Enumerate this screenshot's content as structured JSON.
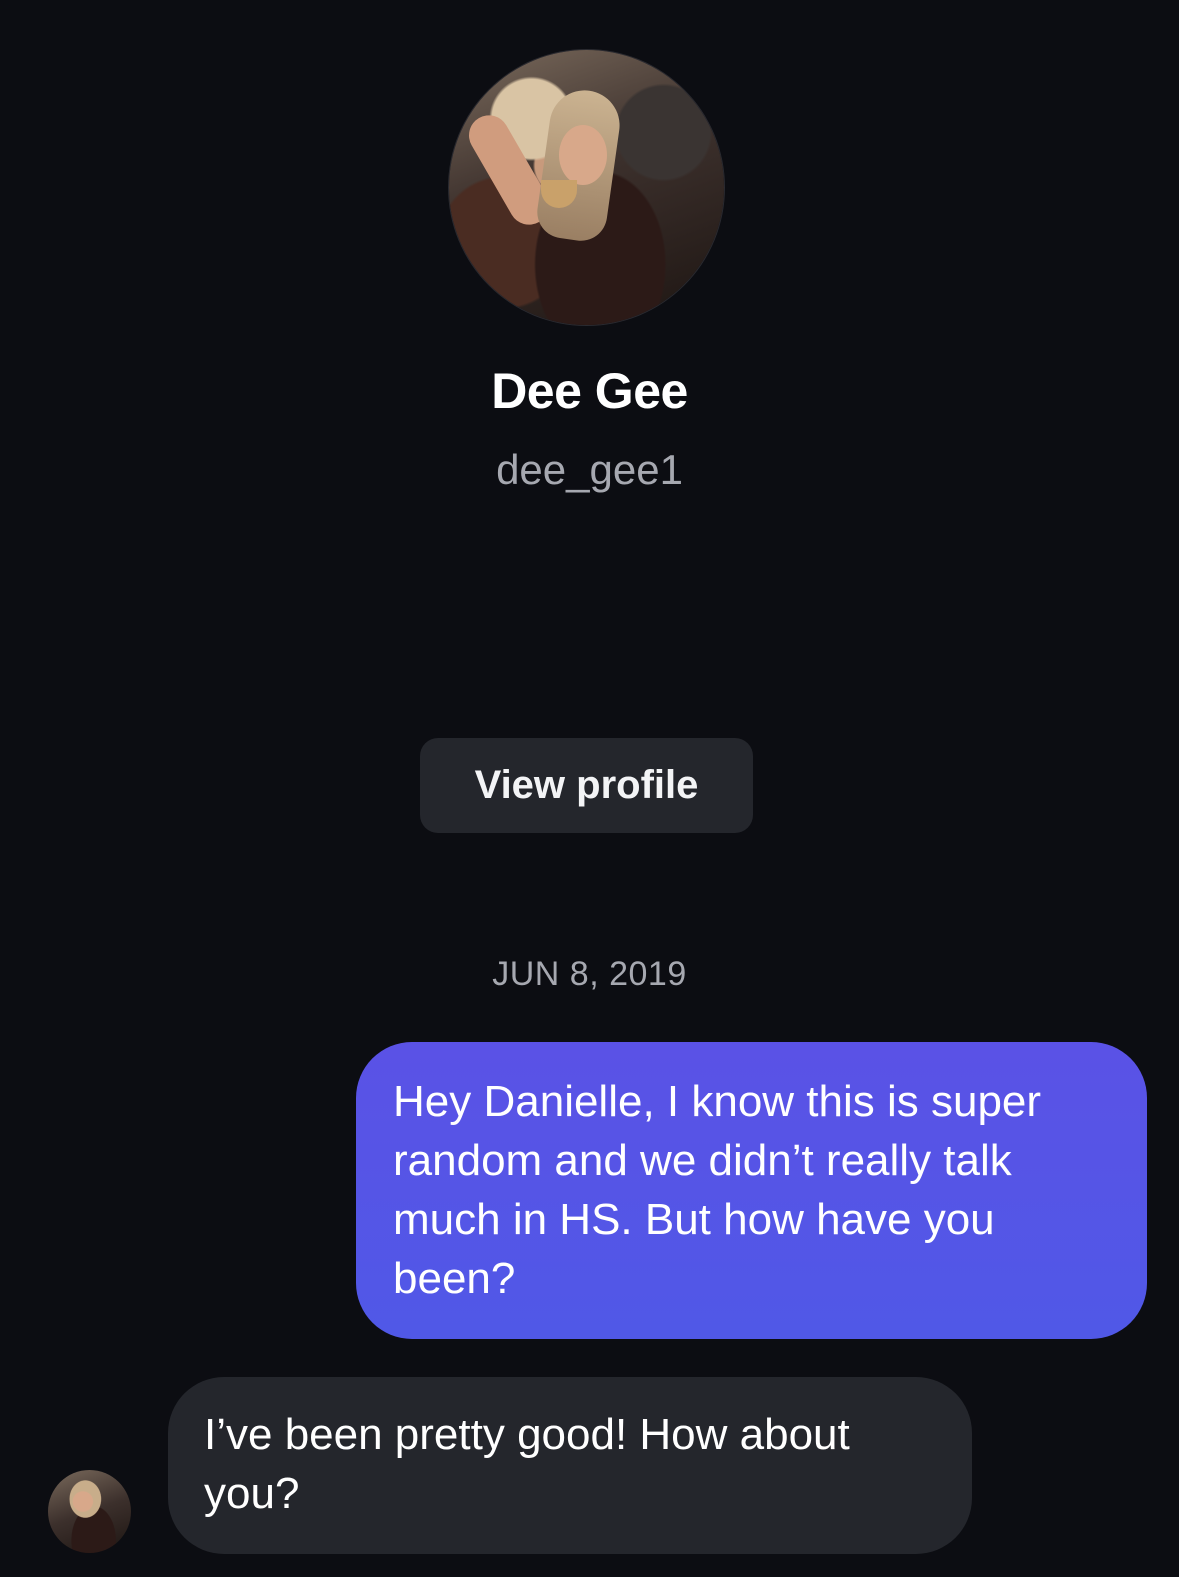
{
  "profile": {
    "display_name": "Dee Gee",
    "username": "dee_gee1",
    "view_profile_label": "View profile"
  },
  "conversation": {
    "date_label": "JUN 8, 2019",
    "messages": [
      {
        "direction": "sent",
        "text": "Hey Danielle, I know this is super random and we didn’t really talk much in HS. But how have you been?"
      },
      {
        "direction": "received",
        "text": "I’ve been pretty good! How about you?"
      }
    ]
  },
  "colors": {
    "background": "#0c0d12",
    "sent_bubble": "#5656e6",
    "received_bubble": "#24262c",
    "secondary_text": "#a6a8b0"
  }
}
